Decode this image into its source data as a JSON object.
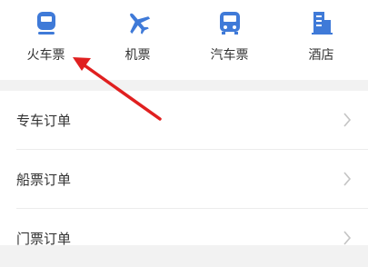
{
  "categories": [
    {
      "label": "火车票",
      "icon": "train-icon"
    },
    {
      "label": "机票",
      "icon": "airplane-icon"
    },
    {
      "label": "汽车票",
      "icon": "bus-icon"
    },
    {
      "label": "酒店",
      "icon": "hotel-icon"
    }
  ],
  "orders": [
    {
      "label": "专车订单"
    },
    {
      "label": "船票订单"
    },
    {
      "label": "门票订单"
    }
  ],
  "colors": {
    "icon_blue": "#3f7ad8",
    "annotation_red": "#e02020",
    "text": "#333333",
    "chevron": "#c4c4c4"
  }
}
